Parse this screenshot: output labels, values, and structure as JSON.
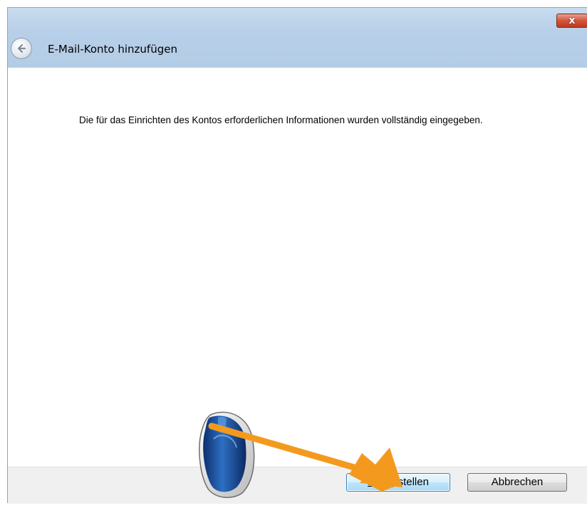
{
  "window": {
    "title": "E-Mail-Konto hinzufügen",
    "close_label": "x"
  },
  "content": {
    "message": "Die für das Einrichten des Kontos erforderlichen Informationen wurden vollständig eingegeben."
  },
  "footer": {
    "finish_label": "Fertig stellen",
    "cancel_label": "Abbrechen"
  },
  "icons": {
    "back": "back-arrow-icon",
    "close": "close-icon",
    "mouse": "computer-mouse-icon",
    "arrow": "orange-pointer-arrow"
  },
  "colors": {
    "titlebar": "#b7cfe8",
    "footer": "#f0f0f0",
    "annotation_arrow": "#f39a1e",
    "close_button": "#c9432a",
    "mouse_body": "#1f4e9a"
  }
}
